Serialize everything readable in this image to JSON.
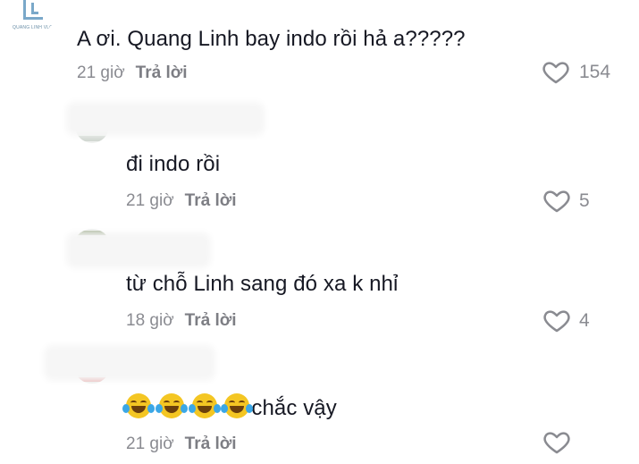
{
  "top_comment": {
    "avatar_logo_text": "QUANG LINH VLOG",
    "text": "A ơi. Quang Linh bay indo rồi hả a?????",
    "time": "21 giờ",
    "reply_label": "Trả lời",
    "likes": "154"
  },
  "replies": [
    {
      "text": "đi indo rồi",
      "time": "21 giờ",
      "reply_label": "Trả lời",
      "likes": "5"
    },
    {
      "text": "từ chỗ Linh sang đó xa k nhỉ",
      "time": "18 giờ",
      "reply_label": "Trả lời",
      "likes": "4"
    },
    {
      "emoji": "face-with-tears-of-joy",
      "emoji_count": 4,
      "text": "chắc vậy",
      "time": "21 giờ",
      "reply_label": "Trả lời",
      "likes": ""
    }
  ],
  "colors": {
    "text": "#161823",
    "meta": "#8a8b91",
    "heart": "#8a8b91",
    "logo": "#7aa8c9"
  }
}
